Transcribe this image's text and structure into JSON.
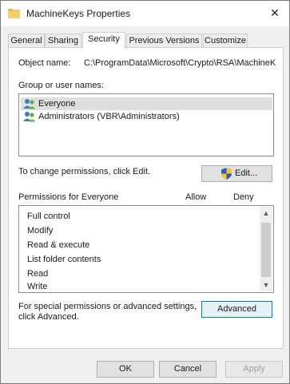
{
  "window": {
    "title": "MachineKeys Properties"
  },
  "tabs": [
    {
      "label": "General"
    },
    {
      "label": "Sharing"
    },
    {
      "label": "Security",
      "active": true
    },
    {
      "label": "Previous Versions"
    },
    {
      "label": "Customize"
    }
  ],
  "security": {
    "object_name_label": "Object name:",
    "object_name_value": "C:\\ProgramData\\Microsoft\\Crypto\\RSA\\MachineK",
    "group_label": "Group or user names:",
    "groups": [
      {
        "label": "Everyone",
        "selected": true
      },
      {
        "label": "Administrators (VBR\\Administrators)",
        "selected": false
      }
    ],
    "change_hint": "To change permissions, click Edit.",
    "edit_button": "Edit...",
    "permissions_for": "Permissions for Everyone",
    "allow_header": "Allow",
    "deny_header": "Deny",
    "permissions": [
      {
        "label": "Full control"
      },
      {
        "label": "Modify"
      },
      {
        "label": "Read & execute"
      },
      {
        "label": "List folder contents"
      },
      {
        "label": "Read"
      },
      {
        "label": "Write"
      }
    ],
    "advanced_hint_line1": "For special permissions or advanced settings,",
    "advanced_hint_line2": "click Advanced.",
    "advanced_button": "Advanced"
  },
  "footer": {
    "ok": "OK",
    "cancel": "Cancel",
    "apply": "Apply"
  },
  "colors": {
    "accent": "#0078d7",
    "folder": "#e8b84a",
    "shield_blue": "#2a5db8",
    "shield_yellow": "#f2c530"
  }
}
